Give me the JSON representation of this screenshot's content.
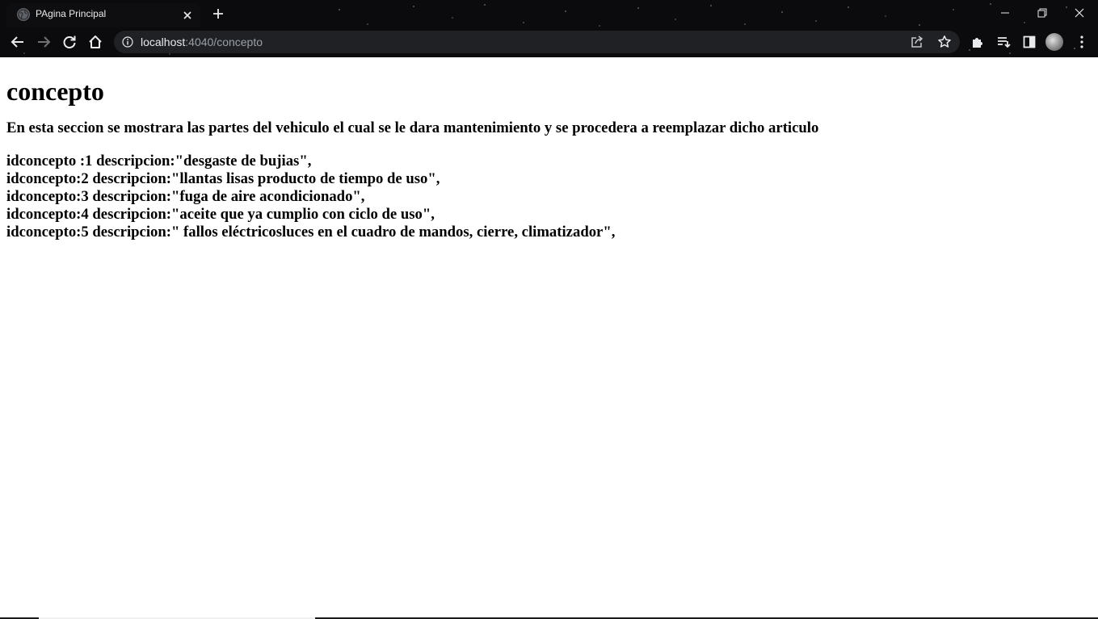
{
  "browser": {
    "tab_title": "PAgina Principal",
    "url_host": "localhost",
    "url_rest": ":4040/concepto",
    "icons": {
      "favicon": "globe-icon",
      "tab_close": "close-icon",
      "new_tab": "plus-icon",
      "minimize": "minimize-icon",
      "restore": "restore-icon",
      "close_window": "close-icon",
      "back": "arrow-left-icon",
      "forward": "arrow-right-icon",
      "reload": "reload-icon",
      "home": "home-icon",
      "site_info": "info-icon",
      "share": "share-icon",
      "bookmark": "star-icon",
      "extensions": "puzzle-icon",
      "reading_list": "playlist-icon",
      "side_panel": "side-panel-icon",
      "profile": "avatar-icon",
      "menu": "kebab-menu-icon"
    }
  },
  "page": {
    "title": "concepto",
    "subtitle": "En esta seccion se mostrara las partes del vehiculo el cual se le dara mantenimiento y se procedera a reemplazar dicho articulo",
    "records": [
      "idconcepto :1 descripcion:\"desgaste de bujias\",",
      "idconcepto:2 descripcion:\"llantas lisas producto de tiempo de uso\",",
      "idconcepto:3 descripcion:\"fuga de aire acondicionado\",",
      "idconcepto:4 descripcion:\"aceite que ya cumplio con ciclo de uso\",",
      "idconcepto:5 descripcion:\" fallos eléctricosluces en el cuadro de mandos, cierre, climatizador\","
    ]
  },
  "colors": {
    "chrome_bg": "#0b0b0d",
    "omnibox_bg": "#202124",
    "chrome_text": "#e8eaed",
    "url_secondary": "#9aa0a6",
    "page_bg": "#ffffff",
    "page_text": "#000000"
  }
}
